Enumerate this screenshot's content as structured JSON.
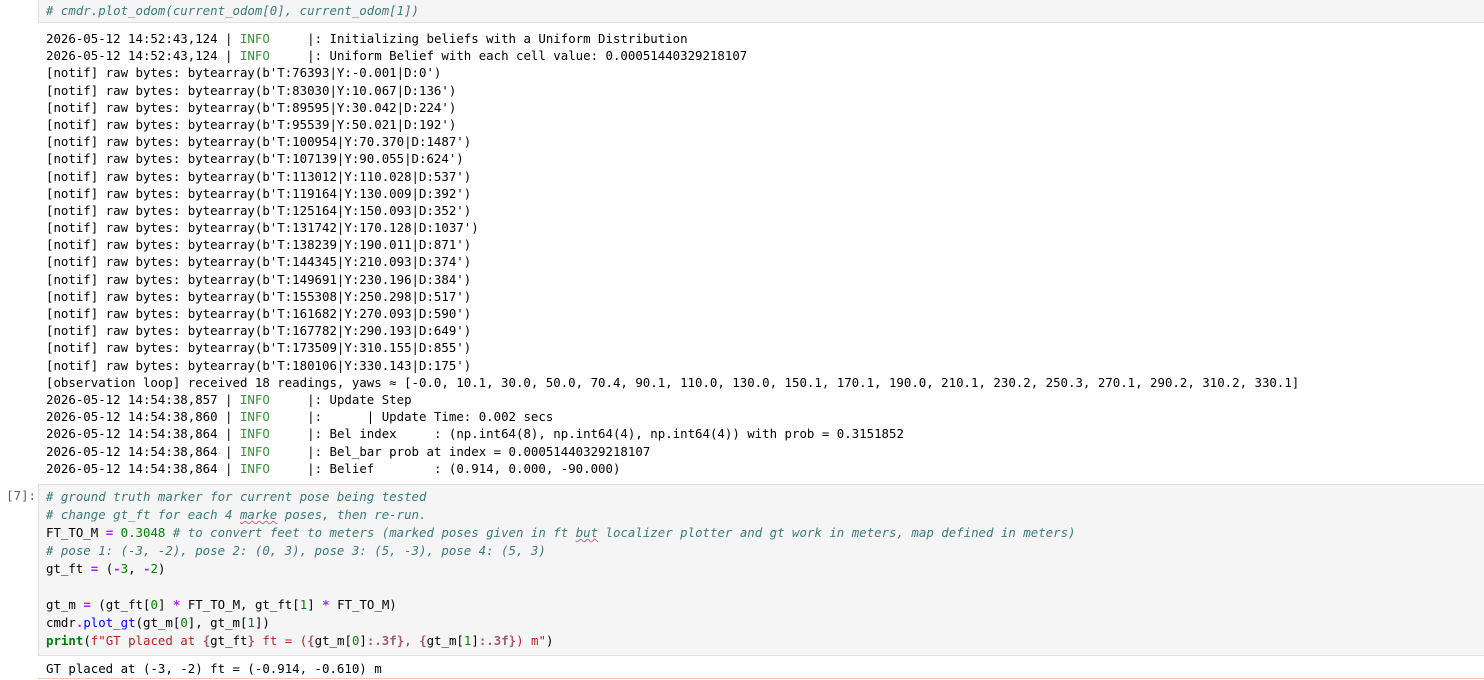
{
  "top_cell": {
    "code_line": "# cmdr.plot_odom(current_odom[0], current_odom[1])"
  },
  "output": {
    "log_lines": [
      {
        "ts": "2026-05-12 14:52:43,124",
        "lvl": "INFO",
        "msg": "|: Initializing beliefs with a Uniform Distribution"
      },
      {
        "ts": "2026-05-12 14:52:43,124",
        "lvl": "INFO",
        "msg": "|: Uniform Belief with each cell value: 0.00051440329218107"
      }
    ],
    "notif_lines": [
      "[notif] raw bytes: bytearray(b'T:76393|Y:-0.001|D:0')",
      "[notif] raw bytes: bytearray(b'T:83030|Y:10.067|D:136')",
      "[notif] raw bytes: bytearray(b'T:89595|Y:30.042|D:224')",
      "[notif] raw bytes: bytearray(b'T:95539|Y:50.021|D:192')",
      "[notif] raw bytes: bytearray(b'T:100954|Y:70.370|D:1487')",
      "[notif] raw bytes: bytearray(b'T:107139|Y:90.055|D:624')",
      "[notif] raw bytes: bytearray(b'T:113012|Y:110.028|D:537')",
      "[notif] raw bytes: bytearray(b'T:119164|Y:130.009|D:392')",
      "[notif] raw bytes: bytearray(b'T:125164|Y:150.093|D:352')",
      "[notif] raw bytes: bytearray(b'T:131742|Y:170.128|D:1037')",
      "[notif] raw bytes: bytearray(b'T:138239|Y:190.011|D:871')",
      "[notif] raw bytes: bytearray(b'T:144345|Y:210.093|D:374')",
      "[notif] raw bytes: bytearray(b'T:149691|Y:230.196|D:384')",
      "[notif] raw bytes: bytearray(b'T:155308|Y:250.298|D:517')",
      "[notif] raw bytes: bytearray(b'T:161682|Y:270.093|D:590')",
      "[notif] raw bytes: bytearray(b'T:167782|Y:290.193|D:649')",
      "[notif] raw bytes: bytearray(b'T:173509|Y:310.155|D:855')",
      "[notif] raw bytes: bytearray(b'T:180106|Y:330.143|D:175')"
    ],
    "observation_line": "[observation loop] received 18 readings, yaws ≈ [-0.0, 10.1, 30.0, 50.0, 70.4, 90.1, 110.0, 130.0, 150.1, 170.1, 190.0, 210.1, 230.2, 250.3, 270.1, 290.2, 310.2, 330.1]",
    "log_lines_2": [
      {
        "ts": "2026-05-12 14:54:38,857",
        "lvl": "INFO",
        "msg": "|: Update Step"
      },
      {
        "ts": "2026-05-12 14:54:38,860",
        "lvl": "INFO",
        "msg": "|:      | Update Time: 0.002 secs"
      },
      {
        "ts": "2026-05-12 14:54:38,864",
        "lvl": "INFO",
        "msg": "|: Bel index     : (np.int64(8), np.int64(4), np.int64(4)) with prob = 0.3151852"
      },
      {
        "ts": "2026-05-12 14:54:38,864",
        "lvl": "INFO",
        "msg": "|: Bel_bar prob at index = 0.00051440329218107"
      },
      {
        "ts": "2026-05-12 14:54:38,864",
        "lvl": "INFO",
        "msg": "|: Belief        : (0.914, 0.000, -90.000)"
      }
    ]
  },
  "cell7": {
    "prompt": "[7]:",
    "comment1": "# ground truth marker for current pose being tested",
    "comment2_pre": "# change gt_ft for each 4 ",
    "comment2_word": "marke",
    "comment2_post": " poses, then re-run.",
    "ft_name": "FT_TO_M",
    "ft_value": "0.3048",
    "ft_comment_pre": "# to convert feet to meters (marked poses given in ft ",
    "ft_comment_word": "but",
    "ft_comment_post": " localizer plotter and gt work in meters, map defined in meters)",
    "comment3": "# pose 1: (-3, -2), pose 2: (0, 3), pose 3: (5, -3), pose 4: (5, 3)",
    "gt_ft_name": "gt_ft",
    "gt_ft_val1": "3",
    "gt_ft_val2": "2",
    "gt_m_name": "gt_m",
    "idx0": "0",
    "idx1": "1",
    "cmdr": "cmdr",
    "plot_fn": "plot_gt",
    "print_fn": "print",
    "fstr_pre": "f\"GT placed at ",
    "fstr_mid1": " ft = (",
    "fstr_mid2": ", ",
    "fstr_end": ") m\"",
    "fmt_spec": ":.3f",
    "output": "GT placed at (-3, -2) ft = (-0.914, -0.610) m"
  }
}
